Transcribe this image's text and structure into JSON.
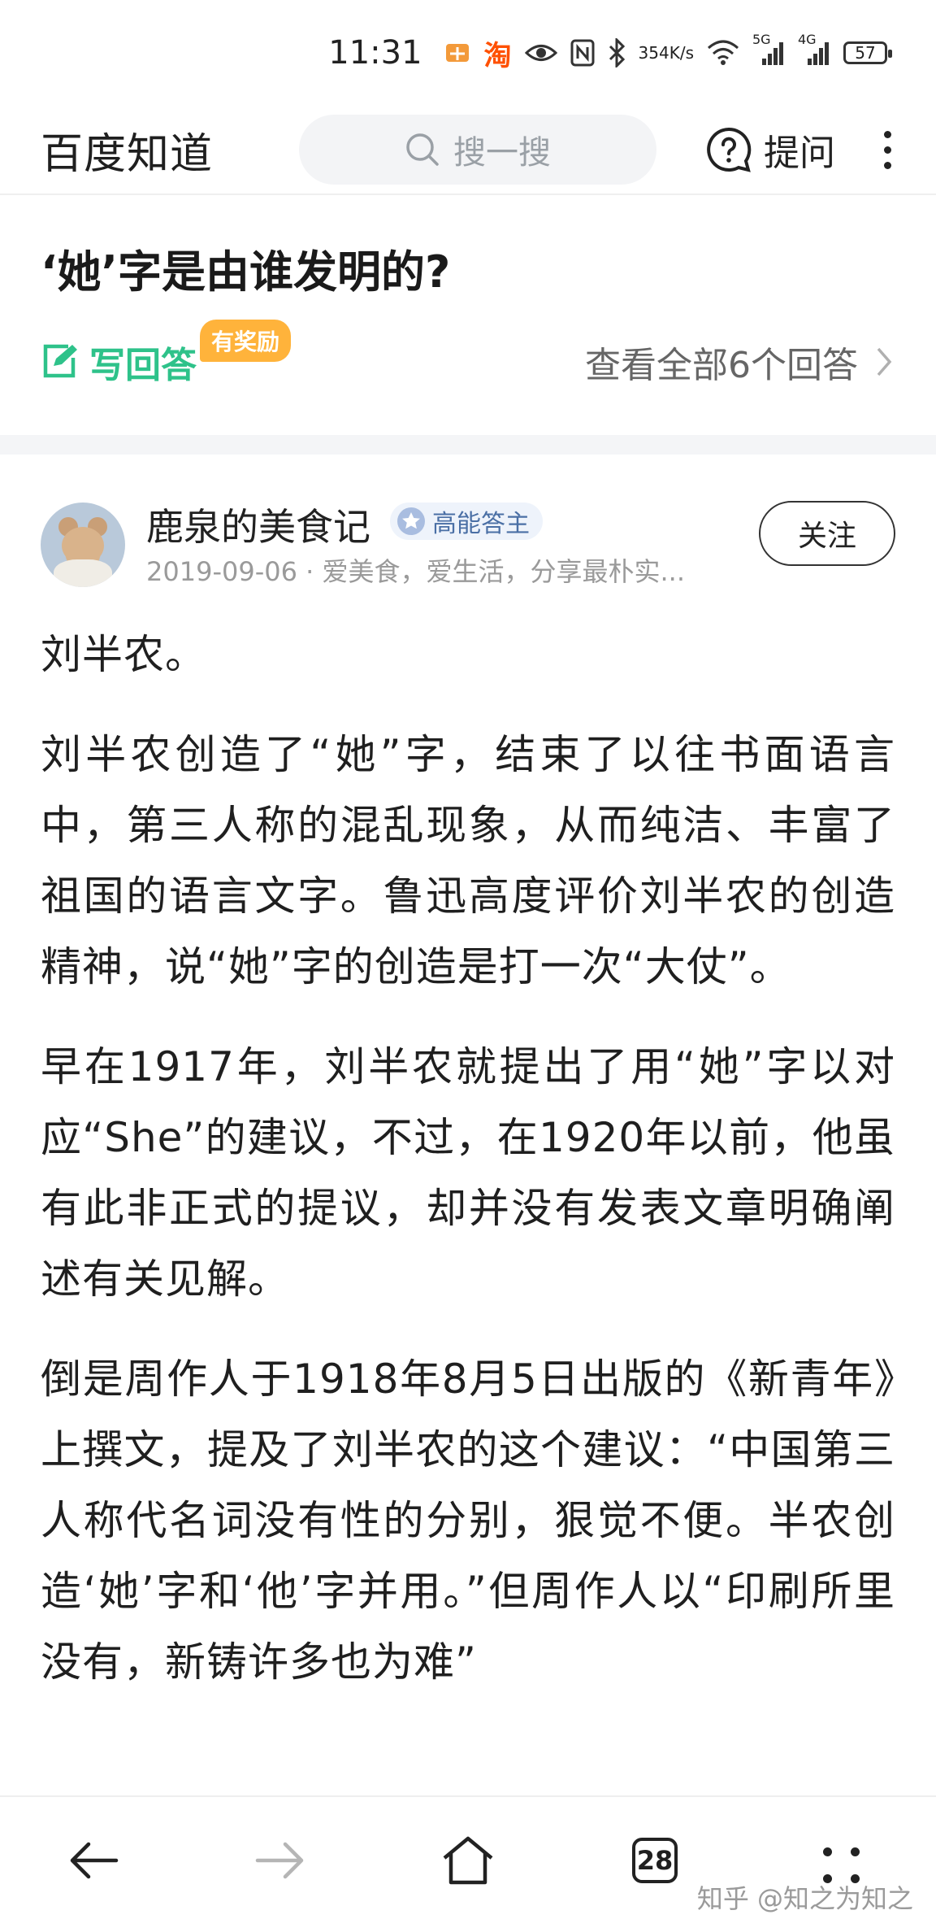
{
  "status_bar": {
    "time": "11:31",
    "speed_value": "354",
    "speed_unit": "K/s",
    "signal1": "5G",
    "signal2": "4G",
    "battery": "57"
  },
  "header": {
    "brand": "百度知道",
    "search_placeholder": "搜一搜",
    "ask_label": "提问"
  },
  "question": {
    "title": "‘她’字是由谁发明的?",
    "write_answer": "写回答",
    "reward_badge": "有奖励",
    "view_all": "查看全部6个回答"
  },
  "answer": {
    "author_name": "鹿泉的美食记",
    "author_badge": "高能答主",
    "meta": "2019-09-06 · 爱美食，爱生活，分享最朴实...",
    "follow_label": "关注",
    "paragraphs": [
      "刘半农。",
      "刘半农创造了“她”字，结束了以往书面语言中，第三人称的混乱现象，从而纯洁、丰富了祖国的语言文字。鲁迅高度评价刘半农的创造精神，说“她”字的创造是打一次“大仗”。",
      "早在1917年，刘半农就提出了用“她”字以对应“She”的建议，不过，在1920年以前，他虽有此非正式的提议，却并没有发表文章明确阐述有关见解。",
      "倒是周作人于1918年8月5日出版的《新青年》上撰文，提及了刘半农的这个建议：“中国第三人称代名词没有性的分别，狠觉不便。半农创造‘她’字和‘他’字并用。”但周作人以“印刷所里没有，新铸许多也为难”"
    ]
  },
  "bottom_nav": {
    "tab_count": "28",
    "watermark": "知乎 @知之为知之"
  },
  "colors": {
    "accent_green": "#2ec28a",
    "reward_orange": "#ffb33b",
    "badge_blue": "#4a6fa5"
  }
}
